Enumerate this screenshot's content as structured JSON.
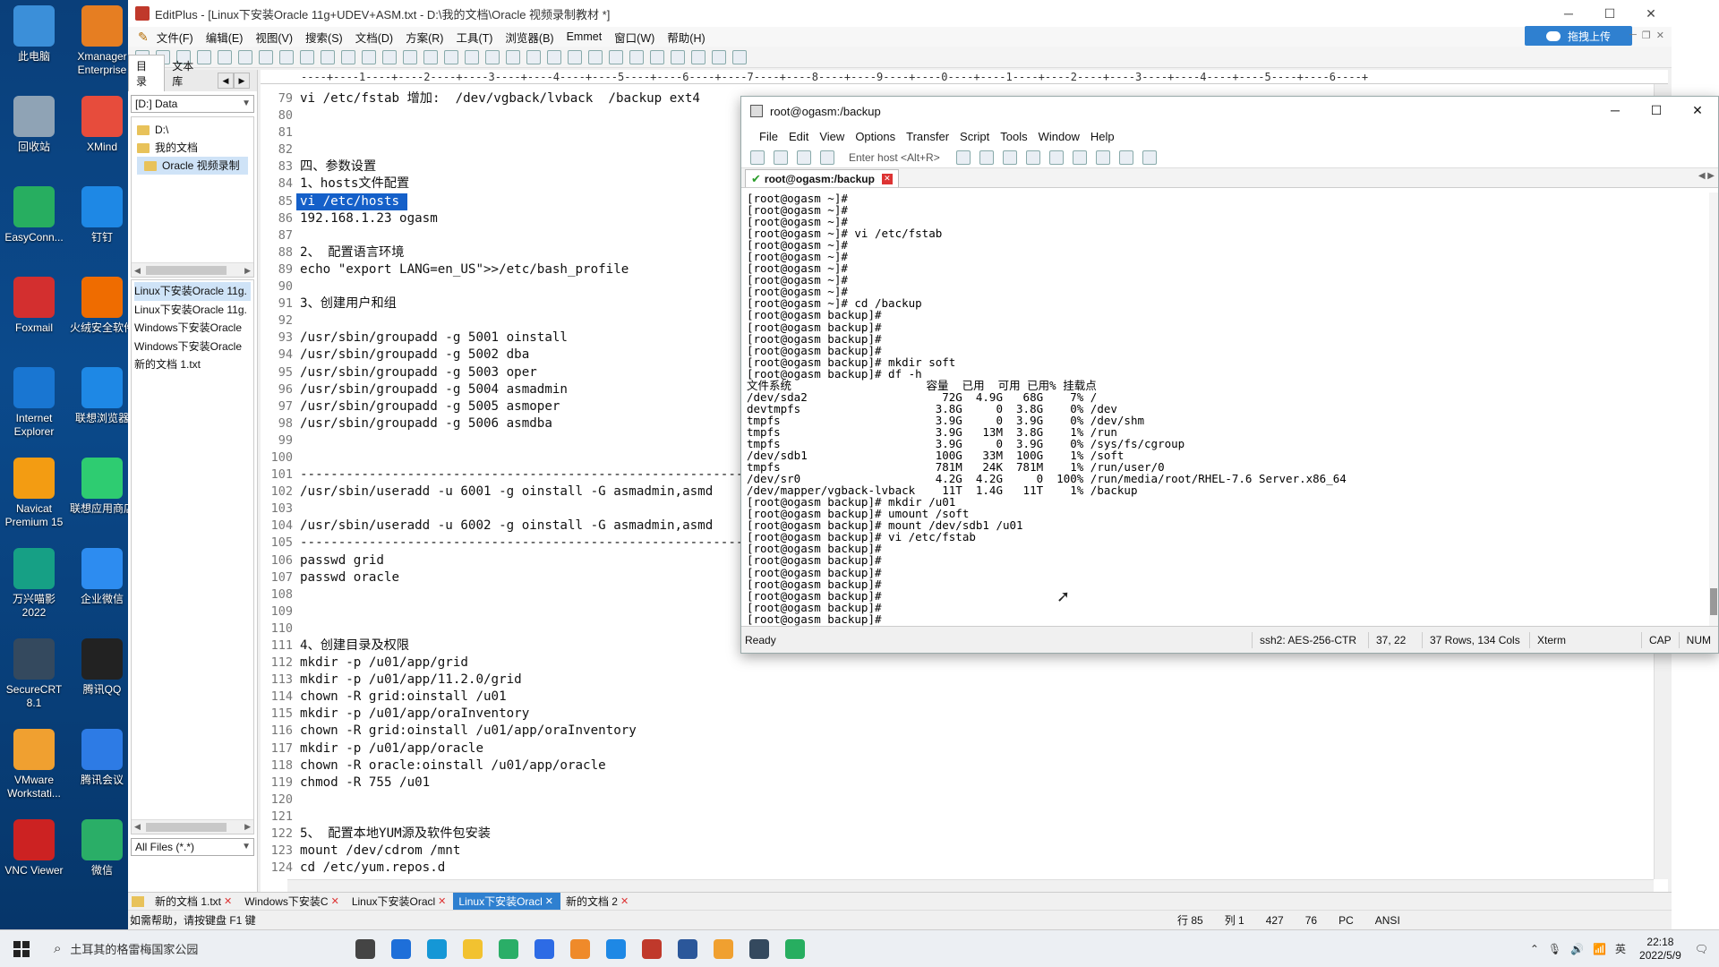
{
  "desktop": {
    "icons": [
      {
        "label": "此电脑",
        "color": "#3b8fd9"
      },
      {
        "label": "Xmanager Enterprise",
        "color": "#e67e22"
      },
      {
        "label": "回收站",
        "color": "#8fa3b5"
      },
      {
        "label": "XMind",
        "color": "#e74c3c"
      },
      {
        "label": "EasyConn...",
        "color": "#27ae60"
      },
      {
        "label": "钉钉",
        "color": "#1e88e5"
      },
      {
        "label": "Foxmail",
        "color": "#d32f2f"
      },
      {
        "label": "火绒安全软件",
        "color": "#ef6c00"
      },
      {
        "label": "Internet Explorer",
        "color": "#1976d2"
      },
      {
        "label": "联想浏览器",
        "color": "#1e88e5"
      },
      {
        "label": "Navicat Premium 15",
        "color": "#f39c12"
      },
      {
        "label": "联想应用商店",
        "color": "#2ecc71"
      },
      {
        "label": "万兴喵影 2022",
        "color": "#16a085"
      },
      {
        "label": "企业微信",
        "color": "#2d8cf0"
      },
      {
        "label": "SecureCRT 8.1",
        "color": "#34495e"
      },
      {
        "label": "腾讯QQ",
        "color": "#222222"
      },
      {
        "label": "VMware Workstati...",
        "color": "#f0a030"
      },
      {
        "label": "腾讯会议",
        "color": "#2d7be5"
      },
      {
        "label": "VNC Viewer",
        "color": "#cc2222"
      },
      {
        "label": "微信",
        "color": "#2aae67"
      }
    ]
  },
  "editplus": {
    "title": "EditPlus - [Linux下安装Oracle 11g+UDEV+ASM.txt - D:\\我的文档\\Oracle 视频录制教材 *]",
    "menu": [
      "文件(F)",
      "编辑(E)",
      "视图(V)",
      "搜索(S)",
      "文档(D)",
      "方案(R)",
      "工具(T)",
      "浏览器(B)",
      "Emmet",
      "窗口(W)",
      "帮助(H)"
    ],
    "upload_label": "拖拽上传",
    "side_tabs": [
      "目录",
      "文本库"
    ],
    "drive": "[D:] Data",
    "folders": [
      "D:\\",
      "我的文档",
      "Oracle 视频录制"
    ],
    "files": [
      "Linux下安装Oracle 11g.",
      "Linux下安装Oracle 11g.",
      "Windows下安装Oracle",
      "Windows下安装Oracle",
      "新的文档 1.txt"
    ],
    "filter": "All Files (*.*)",
    "ruler": "----+----1----+----2----+----3----+----4----+----5----+----6----+----7----+----8----+----9----+----0----+----1----+----2----+----3----+----4----+----5----+----6----+",
    "lines": [
      {
        "n": "79",
        "t": "vi /etc/fstab 增加:  /dev/vgback/lvback  /backup ext4"
      },
      {
        "n": "80",
        "t": ""
      },
      {
        "n": "81",
        "t": ""
      },
      {
        "n": "82",
        "t": ""
      },
      {
        "n": "83",
        "t": "四、参数设置"
      },
      {
        "n": "84",
        "t": "1、hosts文件配置"
      },
      {
        "n": "85",
        "t": "vi /etc/hosts "
      },
      {
        "n": "86",
        "t": "192.168.1.23 ogasm"
      },
      {
        "n": "87",
        "t": ""
      },
      {
        "n": "88",
        "t": "2、 配置语言环境"
      },
      {
        "n": "89",
        "t": "echo \"export LANG=en_US\">>/etc/bash_profile"
      },
      {
        "n": "90",
        "t": ""
      },
      {
        "n": "91",
        "t": "3、创建用户和组"
      },
      {
        "n": "92",
        "t": ""
      },
      {
        "n": "93",
        "t": "/usr/sbin/groupadd -g 5001 oinstall"
      },
      {
        "n": "94",
        "t": "/usr/sbin/groupadd -g 5002 dba"
      },
      {
        "n": "95",
        "t": "/usr/sbin/groupadd -g 5003 oper"
      },
      {
        "n": "96",
        "t": "/usr/sbin/groupadd -g 5004 asmadmin"
      },
      {
        "n": "97",
        "t": "/usr/sbin/groupadd -g 5005 asmoper"
      },
      {
        "n": "98",
        "t": "/usr/sbin/groupadd -g 5006 asmdba"
      },
      {
        "n": "99",
        "t": ""
      },
      {
        "n": "100",
        "t": ""
      },
      {
        "n": "101",
        "t": "------------------------------------------------------------"
      },
      {
        "n": "102",
        "t": "/usr/sbin/useradd -u 6001 -g oinstall -G asmadmin,asmd"
      },
      {
        "n": "103",
        "t": ""
      },
      {
        "n": "104",
        "t": "/usr/sbin/useradd -u 6002 -g oinstall -G asmadmin,asmd"
      },
      {
        "n": "105",
        "t": "------------------------------------------------------------"
      },
      {
        "n": "106",
        "t": "passwd grid"
      },
      {
        "n": "107",
        "t": "passwd oracle"
      },
      {
        "n": "108",
        "t": ""
      },
      {
        "n": "109",
        "t": ""
      },
      {
        "n": "110",
        "t": ""
      },
      {
        "n": "111",
        "t": "4、创建目录及权限"
      },
      {
        "n": "112",
        "t": "mkdir -p /u01/app/grid"
      },
      {
        "n": "113",
        "t": "mkdir -p /u01/app/11.2.0/grid"
      },
      {
        "n": "114",
        "t": "chown -R grid:oinstall /u01"
      },
      {
        "n": "115",
        "t": "mkdir -p /u01/app/oraInventory"
      },
      {
        "n": "116",
        "t": "chown -R grid:oinstall /u01/app/oraInventory"
      },
      {
        "n": "117",
        "t": "mkdir -p /u01/app/oracle"
      },
      {
        "n": "118",
        "t": "chown -R oracle:oinstall /u01/app/oracle"
      },
      {
        "n": "119",
        "t": "chmod -R 755 /u01"
      },
      {
        "n": "120",
        "t": ""
      },
      {
        "n": "121",
        "t": ""
      },
      {
        "n": "122",
        "t": "5、 配置本地YUM源及软件包安装"
      },
      {
        "n": "123",
        "t": "mount /dev/cdrom /mnt"
      },
      {
        "n": "124",
        "t": "cd /etc/yum.repos.d"
      }
    ],
    "highlight_line": "85",
    "doc_tabs": [
      {
        "label": "新的文档 1.txt",
        "active": false
      },
      {
        "label": "Windows下安装C",
        "active": false
      },
      {
        "label": "Linux下安装Oracl",
        "active": false
      },
      {
        "label": "Linux下安装Oracl",
        "active": true
      },
      {
        "label": "新的文档 2",
        "active": false
      }
    ],
    "status": {
      "hint": "如需帮助，请按键盘 F1 键",
      "row": "行 85",
      "col": "列 1",
      "n1": "427",
      "n2": "76",
      "mode": "PC",
      "encoding": "ANSI"
    }
  },
  "securecrt": {
    "title": "root@ogasm:/backup",
    "menu": [
      "File",
      "Edit",
      "View",
      "Options",
      "Transfer",
      "Script",
      "Tools",
      "Window",
      "Help"
    ],
    "host_placeholder": "Enter host <Alt+R>",
    "tab_label": "root@ogasm:/backup",
    "terminal": "[root@ogasm ~]#\n[root@ogasm ~]#\n[root@ogasm ~]#\n[root@ogasm ~]# vi /etc/fstab\n[root@ogasm ~]#\n[root@ogasm ~]#\n[root@ogasm ~]#\n[root@ogasm ~]#\n[root@ogasm ~]#\n[root@ogasm ~]# cd /backup\n[root@ogasm backup]#\n[root@ogasm backup]#\n[root@ogasm backup]#\n[root@ogasm backup]#\n[root@ogasm backup]# mkdir soft\n[root@ogasm backup]# df -h\n文件系统                    容量  已用  可用 已用% 挂载点\n/dev/sda2                    72G  4.9G   68G    7% /\ndevtmpfs                    3.8G     0  3.8G    0% /dev\ntmpfs                       3.9G     0  3.9G    0% /dev/shm\ntmpfs                       3.9G   13M  3.8G    1% /run\ntmpfs                       3.9G     0  3.9G    0% /sys/fs/cgroup\n/dev/sdb1                   100G   33M  100G    1% /soft\ntmpfs                       781M   24K  781M    1% /run/user/0\n/dev/sr0                    4.2G  4.2G     0  100% /run/media/root/RHEL-7.6 Server.x86_64\n/dev/mapper/vgback-lvback    11T  1.4G   11T    1% /backup\n[root@ogasm backup]# mkdir /u01\n[root@ogasm backup]# umount /soft\n[root@ogasm backup]# mount /dev/sdb1 /u01\n[root@ogasm backup]# vi /etc/fstab\n[root@ogasm backup]#\n[root@ogasm backup]#\n[root@ogasm backup]#\n[root@ogasm backup]#\n[root@ogasm backup]#\n[root@ogasm backup]#\n[root@ogasm backup]#",
    "status": {
      "ready": "Ready",
      "cipher": "ssh2: AES-256-CTR",
      "pos": "37,  22",
      "size": "37 Rows, 134 Cols",
      "term": "Xterm",
      "cap": "CAP",
      "num": "NUM"
    }
  },
  "taskbar": {
    "search_text": "土耳其的格雷梅国家公园",
    "apps": [
      {
        "name": "task-view",
        "color": "#444444"
      },
      {
        "name": "mail",
        "color": "#1e6fd9"
      },
      {
        "name": "edge",
        "color": "#1597d6"
      },
      {
        "name": "file-explorer",
        "color": "#f2c230"
      },
      {
        "name": "wechat",
        "color": "#2aae67"
      },
      {
        "name": "app-blue",
        "color": "#2d6be5"
      },
      {
        "name": "app-orange",
        "color": "#ef8a2a"
      },
      {
        "name": "browser",
        "color": "#1e88e5"
      },
      {
        "name": "editplus",
        "color": "#c0392b"
      },
      {
        "name": "word",
        "color": "#2b579a"
      },
      {
        "name": "vmware",
        "color": "#f0a030"
      },
      {
        "name": "securecrt",
        "color": "#34495e"
      },
      {
        "name": "app-green",
        "color": "#27ae60"
      }
    ],
    "time": "22:18",
    "date": "2022/5/9"
  }
}
